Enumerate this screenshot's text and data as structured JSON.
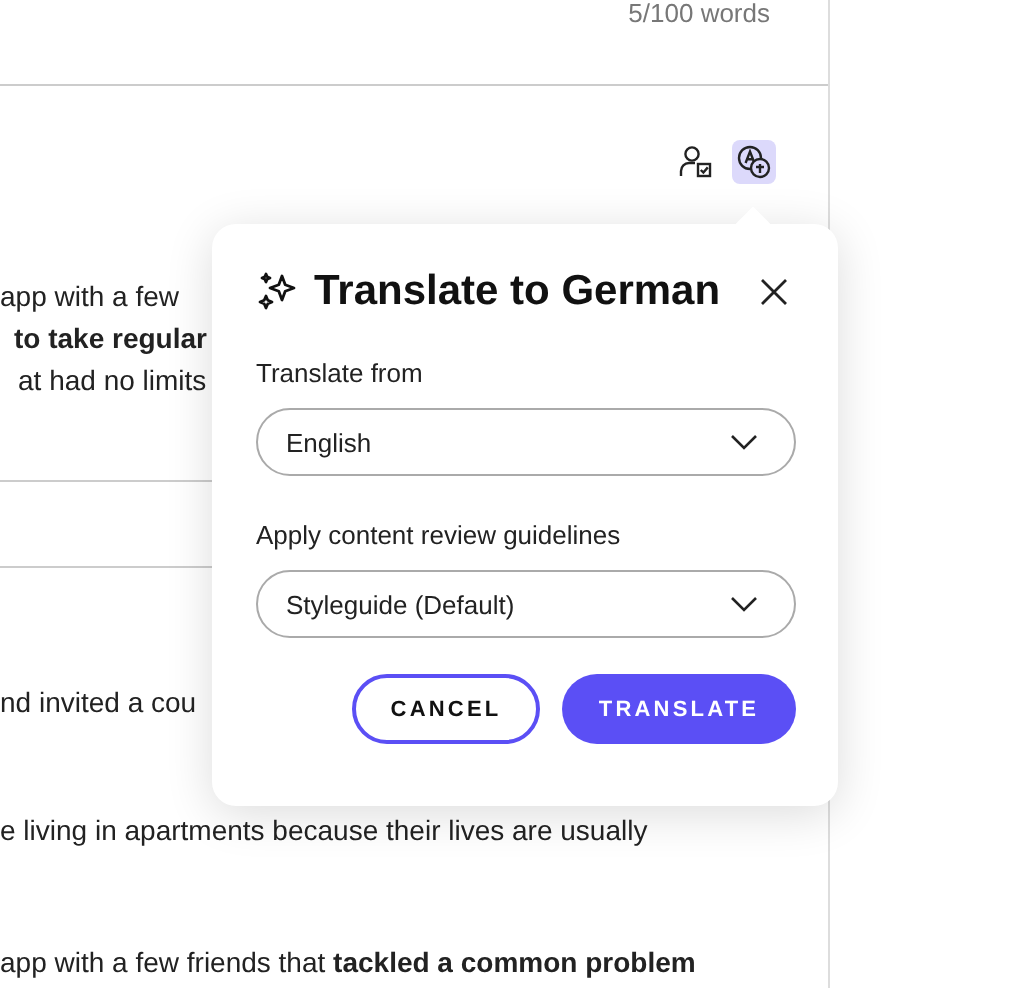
{
  "word_count": "5/100 words",
  "toolbar": [
    {
      "kind": "reviewer",
      "selected": false
    },
    {
      "kind": "translate",
      "selected": true
    }
  ],
  "upper_paragraph": [
    "app with a few",
    "**to take regular**",
    "at had no limits"
  ],
  "lower_paragraphs": [
    "nd invited a cou",
    "e living in apartments because their lives are usually",
    "app with a few friends that **tackled a common problem**"
  ],
  "popover": {
    "title": "Translate to German",
    "fields": [
      {
        "label": "Translate from",
        "value": "English"
      },
      {
        "label": "Apply content review guidelines",
        "value": "Styleguide (Default)"
      }
    ],
    "buttons": [
      {
        "label": "CANCEL",
        "kind": "secondary"
      },
      {
        "label": "TRANSLATE",
        "kind": "primary"
      }
    ]
  }
}
